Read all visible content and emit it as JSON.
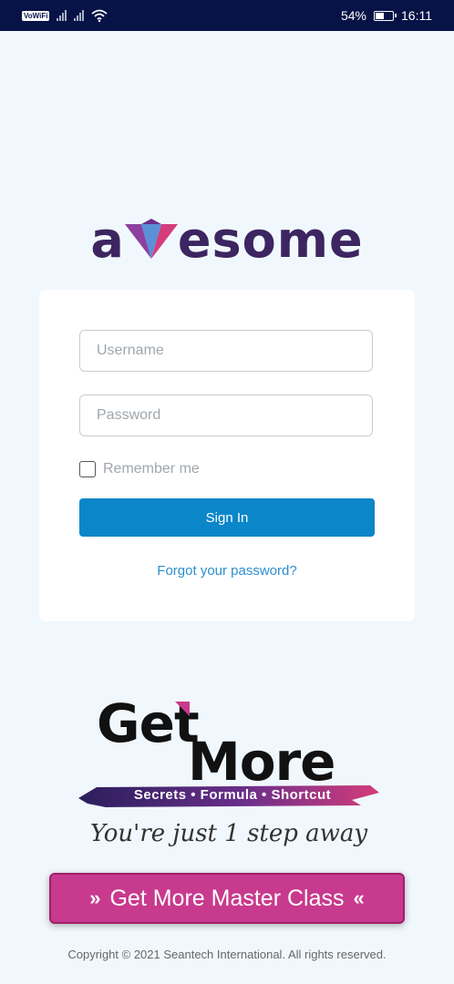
{
  "status_bar": {
    "network_badge": "VoWiFi",
    "battery_percent": "54%",
    "battery_level": 0.54,
    "time": "16:11"
  },
  "brand": {
    "logo_text_start": "a",
    "logo_text_end": "esome",
    "logo_color": "#3c2560",
    "logo_accent_colors": [
      "#8e3fa0",
      "#5b8fd8",
      "#d43c7a"
    ]
  },
  "login": {
    "username_placeholder": "Username",
    "password_placeholder": "Password",
    "remember_label": "Remember me",
    "signin_label": "Sign In",
    "forgot_label": "Forgot your password?",
    "accent_color": "#0a86c9"
  },
  "promo": {
    "get": "Get",
    "more": "More",
    "strip": "Secrets • Formula • Shortcut",
    "tagline": "You're just 1 step away",
    "button_label": "Get More Master Class",
    "button_color": "#c83a8d"
  },
  "footer": {
    "copyright": "Copyright © 2021 Seantech International. All rights reserved."
  }
}
